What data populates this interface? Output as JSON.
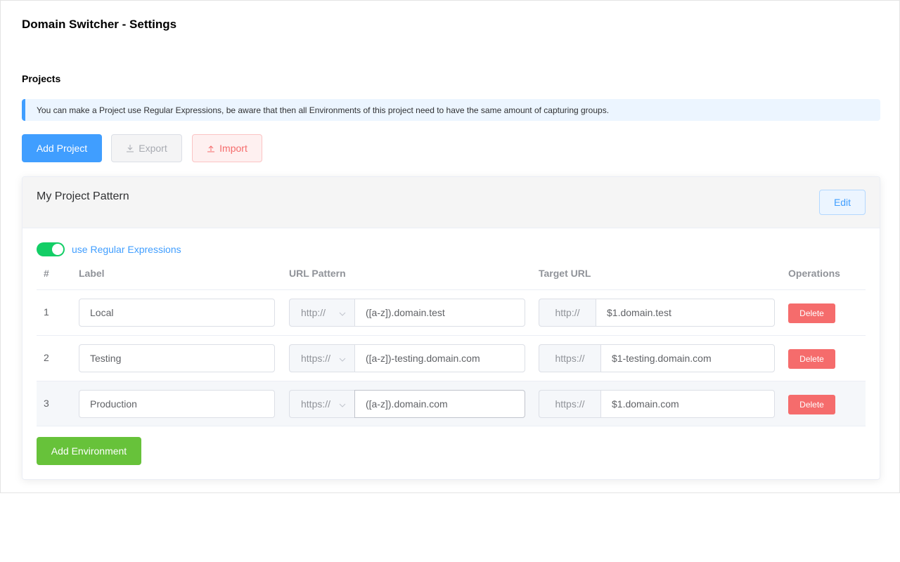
{
  "page": {
    "title": "Domain Switcher - Settings",
    "section_title": "Projects",
    "info_alert": "You can make a Project use Regular Expressions, be aware that then all Environments of this project need to have the same amount of capturing groups."
  },
  "toolbar": {
    "add_project_label": "Add Project",
    "export_label": "Export",
    "export_icon": "download-icon",
    "import_label": "Import",
    "import_icon": "upload-icon"
  },
  "project": {
    "name": "My Project Pattern",
    "edit_label": "Edit",
    "use_regex": true,
    "use_regex_label": "use Regular Expressions",
    "columns": {
      "index": "#",
      "label": "Label",
      "url_pattern": "URL Pattern",
      "target_url": "Target URL",
      "operations": "Operations"
    },
    "environments": [
      {
        "index": "1",
        "label": "Local",
        "pattern_protocol": "http://",
        "pattern": "([a-z]).domain.test",
        "target_protocol": "http://",
        "target": "$1.domain.test",
        "delete_label": "Delete"
      },
      {
        "index": "2",
        "label": "Testing",
        "pattern_protocol": "https://",
        "pattern": "([a-z])-testing.domain.com",
        "target_protocol": "https://",
        "target": "$1-testing.domain.com",
        "delete_label": "Delete"
      },
      {
        "index": "3",
        "label": "Production",
        "pattern_protocol": "https://",
        "pattern": "([a-z]).domain.com",
        "target_protocol": "https://",
        "target": "$1.domain.com",
        "delete_label": "Delete"
      }
    ],
    "add_environment_label": "Add Environment"
  },
  "colors": {
    "primary": "#409eff",
    "success": "#67c23a",
    "danger": "#f56c6c",
    "switch_on": "#13ce66"
  }
}
